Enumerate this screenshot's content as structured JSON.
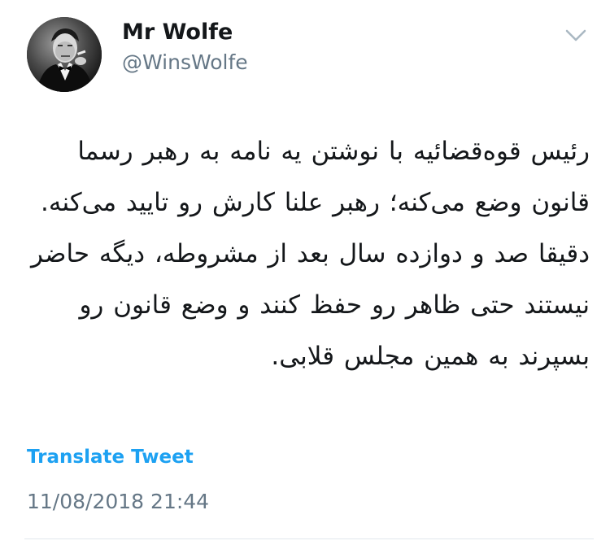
{
  "tweet": {
    "author": {
      "display_name": "Mr Wolfe",
      "handle": "@WinsWolfe"
    },
    "body": "رئیس قوه‌قضائیه با نوشتن یه نامه به رهبر رسما قانون وضع می‌کنه؛ رهبر علنا کارش رو تایید می‌کنه. دقیقا صد و دوازده سال بعد از مشروطه، دیگه حاضر نیستند حتی ظاهر رو حفظ کنند و وضع قانون رو بسپرند به همین مجلس قلابی.",
    "translate_label": "Translate Tweet",
    "timestamp": "11/08/2018 21:44"
  },
  "icons": {
    "menu": "chevron-down-icon",
    "avatar": "user-avatar"
  },
  "colors": {
    "link": "#1da1f2",
    "secondary_text": "#657786",
    "primary_text": "#14171a"
  }
}
